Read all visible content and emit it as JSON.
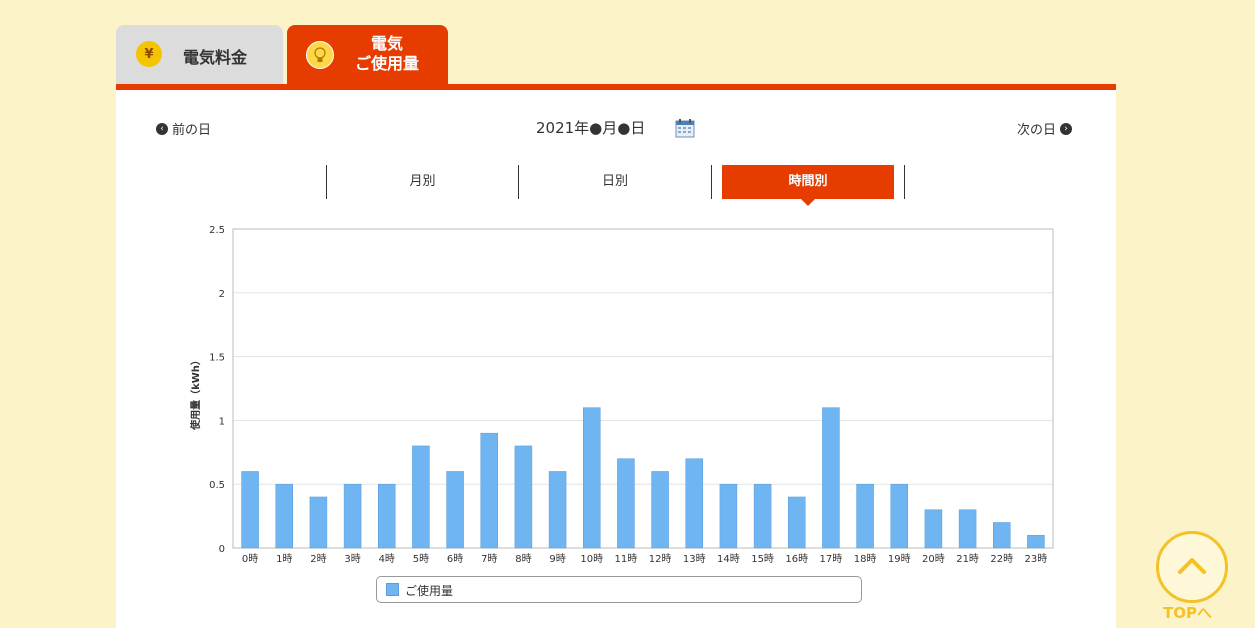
{
  "tabs": [
    {
      "label": "電気料金",
      "icon": "yen-bulb-icon",
      "active": false
    },
    {
      "label_line1": "電気",
      "label_line2": "ご使用量",
      "icon": "lightbulb-icon",
      "active": true
    }
  ],
  "nav": {
    "prev_label": "前の日",
    "next_label": "次の日",
    "date_label": "2021年●月●日",
    "calendar_icon": "calendar-icon"
  },
  "period_tabs": [
    {
      "label": "月別",
      "active": false
    },
    {
      "label": "日別",
      "active": false
    },
    {
      "label": "時間別",
      "active": true
    }
  ],
  "chart_data": {
    "type": "bar",
    "ylabel": "使用量（kWh）",
    "ylim": [
      0,
      2.5
    ],
    "yticks": [
      "2.5",
      "2",
      "1.5",
      "1",
      "0.5",
      "0"
    ],
    "categories": [
      "0時",
      "1時",
      "2時",
      "3時",
      "4時",
      "5時",
      "6時",
      "7時",
      "8時",
      "9時",
      "10時",
      "11時",
      "12時",
      "13時",
      "14時",
      "15時",
      "16時",
      "17時",
      "18時",
      "19時",
      "20時",
      "21時",
      "22時",
      "23時"
    ],
    "series": [
      {
        "name": "ご使用量",
        "color": "#6fb5f2",
        "values": [
          0.6,
          0.5,
          0.4,
          0.5,
          0.5,
          0.8,
          0.6,
          0.9,
          0.8,
          0.6,
          1.1,
          0.7,
          0.6,
          0.7,
          0.5,
          0.5,
          0.4,
          1.1,
          0.5,
          0.5,
          0.3,
          0.3,
          0.2,
          0.1
        ]
      }
    ],
    "grid": true,
    "legend": "bottom"
  },
  "legend_label": "ご使用量",
  "top_button": {
    "label": "TOPへ",
    "icon": "chevron-up-icon"
  },
  "colors": {
    "accent": "#e63c00",
    "bar": "#6fb5f2",
    "background": "#fdf3c8",
    "top_button": "#f3c326"
  }
}
